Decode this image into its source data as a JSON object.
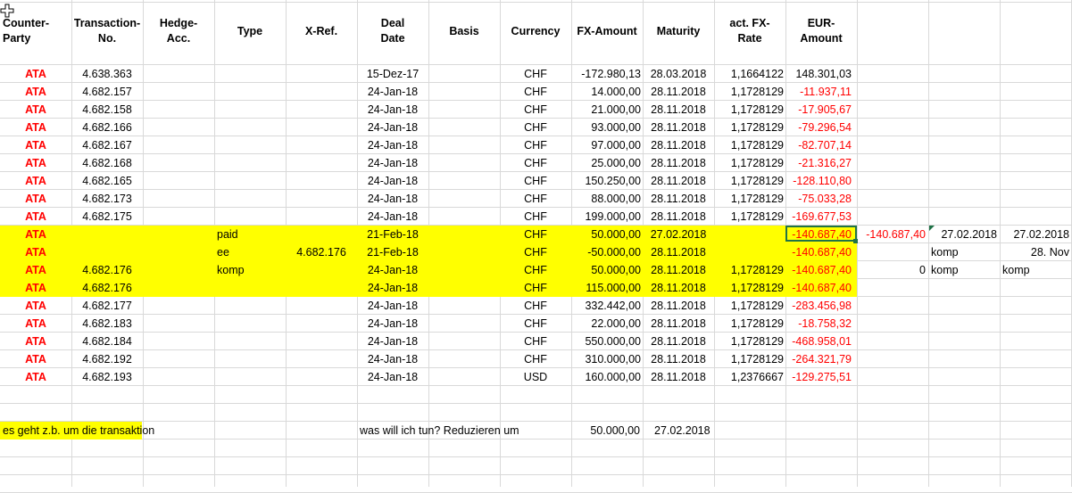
{
  "headers": {
    "counterparty": "Counter-\nParty",
    "transaction": "Transaction-\nNo.",
    "hedge": "Hedge-\nAcc.",
    "type": "Type",
    "xref": "X-Ref.",
    "deal_date": "Deal\nDate",
    "basis": "Basis",
    "currency": "Currency",
    "fx_amount": "FX-Amount",
    "maturity": "Maturity",
    "fx_rate": "act. FX-\nRate",
    "eur_amount": "EUR-\nAmount"
  },
  "rows": [
    {
      "cp": "ATA",
      "tx": "4.638.363",
      "type": "",
      "xref": "",
      "date": "15-Dez-17",
      "cur": "CHF",
      "fx": "-172.980,13",
      "mat": "28.03.2018",
      "rate": "1,1664122",
      "eur": "148.301,03",
      "eur_neg": false,
      "hl": false
    },
    {
      "cp": "ATA",
      "tx": "4.682.157",
      "type": "",
      "xref": "",
      "date": "24-Jan-18",
      "cur": "CHF",
      "fx": "14.000,00",
      "mat": "28.11.2018",
      "rate": "1,1728129",
      "eur": "-11.937,11",
      "eur_neg": true,
      "hl": false
    },
    {
      "cp": "ATA",
      "tx": "4.682.158",
      "type": "",
      "xref": "",
      "date": "24-Jan-18",
      "cur": "CHF",
      "fx": "21.000,00",
      "mat": "28.11.2018",
      "rate": "1,1728129",
      "eur": "-17.905,67",
      "eur_neg": true,
      "hl": false
    },
    {
      "cp": "ATA",
      "tx": "4.682.166",
      "type": "",
      "xref": "",
      "date": "24-Jan-18",
      "cur": "CHF",
      "fx": "93.000,00",
      "mat": "28.11.2018",
      "rate": "1,1728129",
      "eur": "-79.296,54",
      "eur_neg": true,
      "hl": false
    },
    {
      "cp": "ATA",
      "tx": "4.682.167",
      "type": "",
      "xref": "",
      "date": "24-Jan-18",
      "cur": "CHF",
      "fx": "97.000,00",
      "mat": "28.11.2018",
      "rate": "1,1728129",
      "eur": "-82.707,14",
      "eur_neg": true,
      "hl": false
    },
    {
      "cp": "ATA",
      "tx": "4.682.168",
      "type": "",
      "xref": "",
      "date": "24-Jan-18",
      "cur": "CHF",
      "fx": "25.000,00",
      "mat": "28.11.2018",
      "rate": "1,1728129",
      "eur": "-21.316,27",
      "eur_neg": true,
      "hl": false
    },
    {
      "cp": "ATA",
      "tx": "4.682.165",
      "type": "",
      "xref": "",
      "date": "24-Jan-18",
      "cur": "CHF",
      "fx": "150.250,00",
      "mat": "28.11.2018",
      "rate": "1,1728129",
      "eur": "-128.110,80",
      "eur_neg": true,
      "hl": false
    },
    {
      "cp": "ATA",
      "tx": "4.682.173",
      "type": "",
      "xref": "",
      "date": "24-Jan-18",
      "cur": "CHF",
      "fx": "88.000,00",
      "mat": "28.11.2018",
      "rate": "1,1728129",
      "eur": "-75.033,28",
      "eur_neg": true,
      "hl": false
    },
    {
      "cp": "ATA",
      "tx": "4.682.175",
      "type": "",
      "xref": "",
      "date": "24-Jan-18",
      "cur": "CHF",
      "fx": "199.000,00",
      "mat": "28.11.2018",
      "rate": "1,1728129",
      "eur": "-169.677,53",
      "eur_neg": true,
      "hl": false
    },
    {
      "cp": "ATA",
      "tx": "",
      "type": "paid",
      "xref": "",
      "date": "21-Feb-18",
      "cur": "CHF",
      "fx": "50.000,00",
      "mat": "27.02.2018",
      "rate": "",
      "eur": "-140.687,40",
      "eur_neg": true,
      "hl": true
    },
    {
      "cp": "ATA",
      "tx": "",
      "type": "ee",
      "xref": "4.682.176",
      "date": "21-Feb-18",
      "cur": "CHF",
      "fx": "-50.000,00",
      "mat": "28.11.2018",
      "rate": "",
      "eur": "-140.687,40",
      "eur_neg": true,
      "hl": true
    },
    {
      "cp": "ATA",
      "tx": "4.682.176",
      "type": "komp",
      "xref": "",
      "date": "24-Jan-18",
      "cur": "CHF",
      "fx": "50.000,00",
      "mat": "28.11.2018",
      "rate": "1,1728129",
      "eur": "-140.687,40",
      "eur_neg": true,
      "hl": true
    },
    {
      "cp": "ATA",
      "tx": "4.682.176",
      "type": "",
      "xref": "",
      "date": "24-Jan-18",
      "cur": "CHF",
      "fx": "115.000,00",
      "mat": "28.11.2018",
      "rate": "1,1728129",
      "eur": "-140.687,40",
      "eur_neg": true,
      "hl": true
    },
    {
      "cp": "ATA",
      "tx": "4.682.177",
      "type": "",
      "xref": "",
      "date": "24-Jan-18",
      "cur": "CHF",
      "fx": "332.442,00",
      "mat": "28.11.2018",
      "rate": "1,1728129",
      "eur": "-283.456,98",
      "eur_neg": true,
      "hl": false
    },
    {
      "cp": "ATA",
      "tx": "4.682.183",
      "type": "",
      "xref": "",
      "date": "24-Jan-18",
      "cur": "CHF",
      "fx": "22.000,00",
      "mat": "28.11.2018",
      "rate": "1,1728129",
      "eur": "-18.758,32",
      "eur_neg": true,
      "hl": false
    },
    {
      "cp": "ATA",
      "tx": "4.682.184",
      "type": "",
      "xref": "",
      "date": "24-Jan-18",
      "cur": "CHF",
      "fx": "550.000,00",
      "mat": "28.11.2018",
      "rate": "1,1728129",
      "eur": "-468.958,01",
      "eur_neg": true,
      "hl": false
    },
    {
      "cp": "ATA",
      "tx": "4.682.192",
      "type": "",
      "xref": "",
      "date": "24-Jan-18",
      "cur": "CHF",
      "fx": "310.000,00",
      "mat": "28.11.2018",
      "rate": "1,1728129",
      "eur": "-264.321,79",
      "eur_neg": true,
      "hl": false
    },
    {
      "cp": "ATA",
      "tx": "4.682.193",
      "type": "",
      "xref": "",
      "date": "24-Jan-18",
      "cur": "USD",
      "fx": "160.000,00",
      "mat": "28.11.2018",
      "rate": "1,2376667",
      "eur": "-129.275,51",
      "eur_neg": true,
      "hl": false
    }
  ],
  "side": {
    "l_r10": "-140.687,40",
    "m_r10": "27.02.2018",
    "n_r10": "27.02.2018",
    "m_r11": "komp",
    "n_r11": "28. Nov",
    "l_r12": "0",
    "m_r12": "komp",
    "n_r12": "komp"
  },
  "notes": {
    "left": "es geht z.b. um die transaktion",
    "question": "was will ich tun? Reduzieren um",
    "amount": "50.000,00",
    "date": "27.02.2018"
  }
}
